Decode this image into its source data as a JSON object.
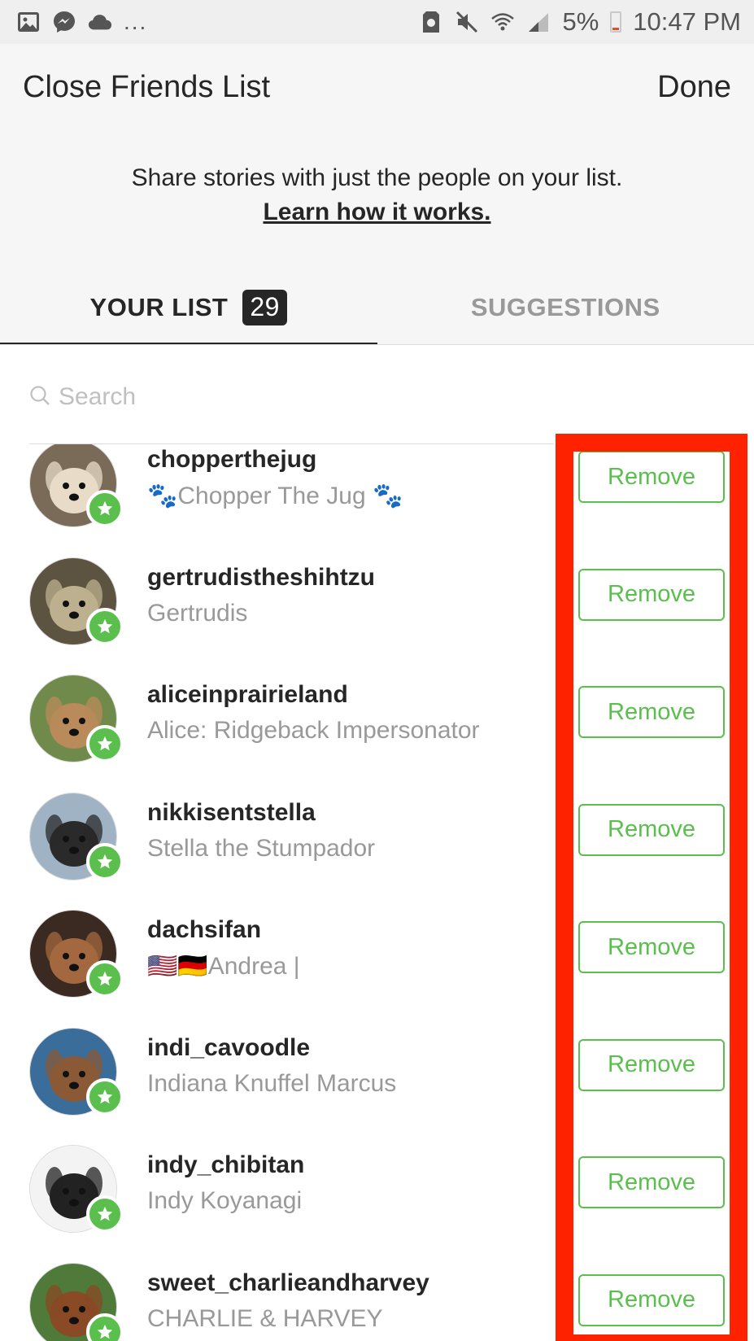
{
  "status_bar": {
    "battery": "5%",
    "time": "10:47 PM",
    "overflow": "...",
    "left_icons": [
      "gallery-icon",
      "messenger-icon",
      "cloud-icon"
    ],
    "right_icons": [
      "storage-icon",
      "mute-icon",
      "wifi-icon",
      "signal-icon",
      "battery-icon"
    ]
  },
  "header": {
    "title": "Close Friends List",
    "done_label": "Done",
    "description": "Share stories with just the people on your list.",
    "learn_link": "Learn how it works."
  },
  "tabs": {
    "your_list": "YOUR LIST",
    "count": "29",
    "suggestions": "SUGGESTIONS"
  },
  "search": {
    "placeholder": "Search"
  },
  "colors": {
    "accent_green": "#5bbf4e",
    "annotation_red": "#ff2200",
    "text_dark": "#262626",
    "text_gray": "#999999"
  },
  "friends": [
    {
      "username": "chopperthejug",
      "full_name": "🐾Chopper The Jug 🐾",
      "action": "Remove",
      "avatar_color": "#7a6a58",
      "avatar_face": "#e8dcc8"
    },
    {
      "username": "gertrudistheshihtzu",
      "full_name": "Gertrudis",
      "action": "Remove",
      "avatar_color": "#5c5340",
      "avatar_face": "#bdb08f"
    },
    {
      "username": "aliceinprairieland",
      "full_name": "Alice: Ridgeback Impersonator",
      "action": "Remove",
      "avatar_color": "#6f8a4a",
      "avatar_face": "#b98a5a"
    },
    {
      "username": "nikkisentstella",
      "full_name": "Stella the Stumpador",
      "action": "Remove",
      "avatar_color": "#9fb3c4",
      "avatar_face": "#2a2a2a"
    },
    {
      "username": "dachsifan",
      "full_name": "🇺🇸🇩🇪Andrea |",
      "action": "Remove",
      "avatar_color": "#3a2a22",
      "avatar_face": "#a3683f"
    },
    {
      "username": "indi_cavoodle",
      "full_name": "Indiana Knuffel Marcus",
      "action": "Remove",
      "avatar_color": "#3b6d9a",
      "avatar_face": "#8a5a36"
    },
    {
      "username": "indy_chibitan",
      "full_name": "Indy Koyanagi",
      "action": "Remove",
      "avatar_color": "#f3f3f3",
      "avatar_face": "#222222"
    },
    {
      "username": "sweet_charlieandharvey",
      "full_name": "CHARLIE & HARVEY",
      "action": "Remove",
      "avatar_color": "#4f7a3a",
      "avatar_face": "#8a4a25"
    }
  ]
}
